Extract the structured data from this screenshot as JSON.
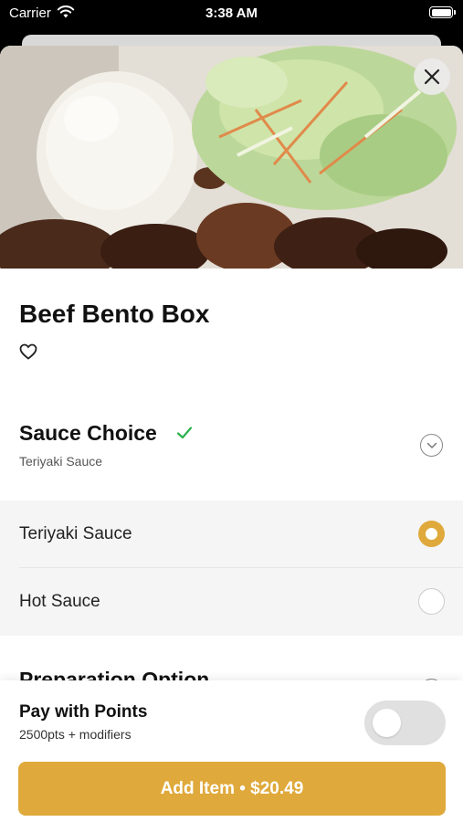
{
  "status_bar": {
    "carrier": "Carrier",
    "time": "3:38 AM"
  },
  "item": {
    "title": "Beef Bento Box",
    "price_button": "Add Item • $20.49"
  },
  "sauce": {
    "title": "Sauce Choice",
    "selected_summary": "Teriyaki Sauce",
    "options": [
      {
        "label": "Teriyaki Sauce",
        "selected": true
      },
      {
        "label": "Hot Sauce",
        "selected": false
      }
    ]
  },
  "next_section": {
    "title": "Preparation Option"
  },
  "points": {
    "title": "Pay with Points",
    "subtitle": "2500pts + modifiers",
    "enabled": false
  },
  "colors": {
    "accent": "#dfa93b",
    "check": "#2bb24c"
  }
}
